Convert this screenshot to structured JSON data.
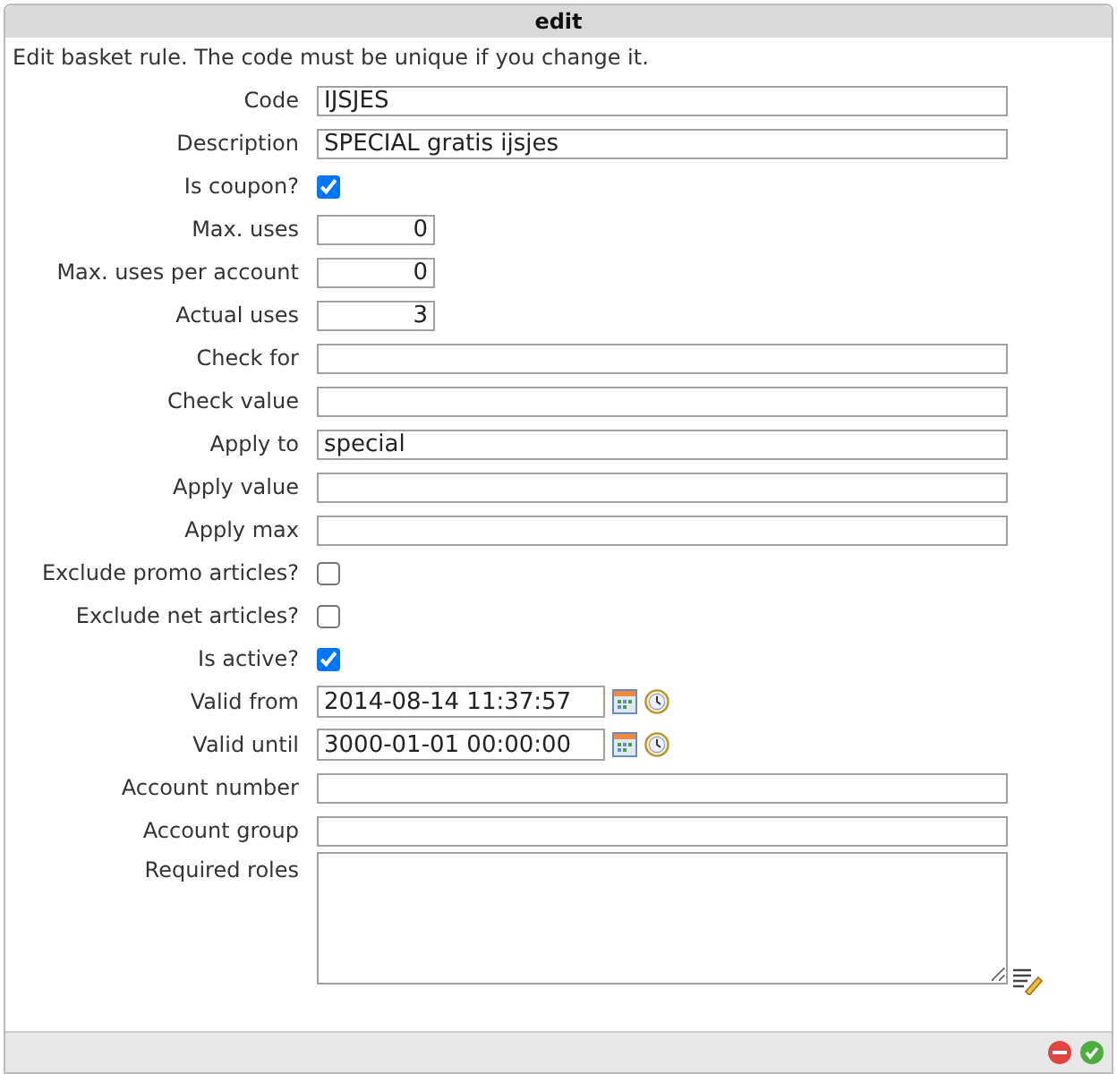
{
  "window": {
    "title": "edit"
  },
  "intro": "Edit basket rule. The code must be unique if you change it.",
  "fields": [
    {
      "label": "Code",
      "kind": "text",
      "value": "IJSJES"
    },
    {
      "label": "Description",
      "kind": "text",
      "value": "SPECIAL gratis ijsjes"
    },
    {
      "label": "Is coupon?",
      "kind": "checkbox",
      "checked": true
    },
    {
      "label": "Max. uses",
      "kind": "number",
      "value": "0"
    },
    {
      "label": "Max. uses per account",
      "kind": "number",
      "value": "0"
    },
    {
      "label": "Actual uses",
      "kind": "number",
      "value": "3"
    },
    {
      "label": "Check for",
      "kind": "text"
    },
    {
      "label": "Check value",
      "kind": "text"
    },
    {
      "label": "Apply to",
      "kind": "text",
      "value": "special"
    },
    {
      "label": "Apply value",
      "kind": "text"
    },
    {
      "label": "Apply max",
      "kind": "text"
    },
    {
      "label": "Exclude promo articles?",
      "kind": "checkbox",
      "checked": false
    },
    {
      "label": "Exclude net articles?",
      "kind": "checkbox",
      "checked": false
    },
    {
      "label": "Is active?",
      "kind": "checkbox",
      "checked": true
    },
    {
      "label": "Valid from",
      "kind": "datetime",
      "value": "2014-08-14 11:37:57"
    },
    {
      "label": "Valid until",
      "kind": "datetime",
      "value": "3000-01-01 00:00:00"
    },
    {
      "label": "Account number",
      "kind": "text"
    },
    {
      "label": "Account group",
      "kind": "text"
    },
    {
      "label": "Required roles",
      "kind": "textarea"
    }
  ]
}
